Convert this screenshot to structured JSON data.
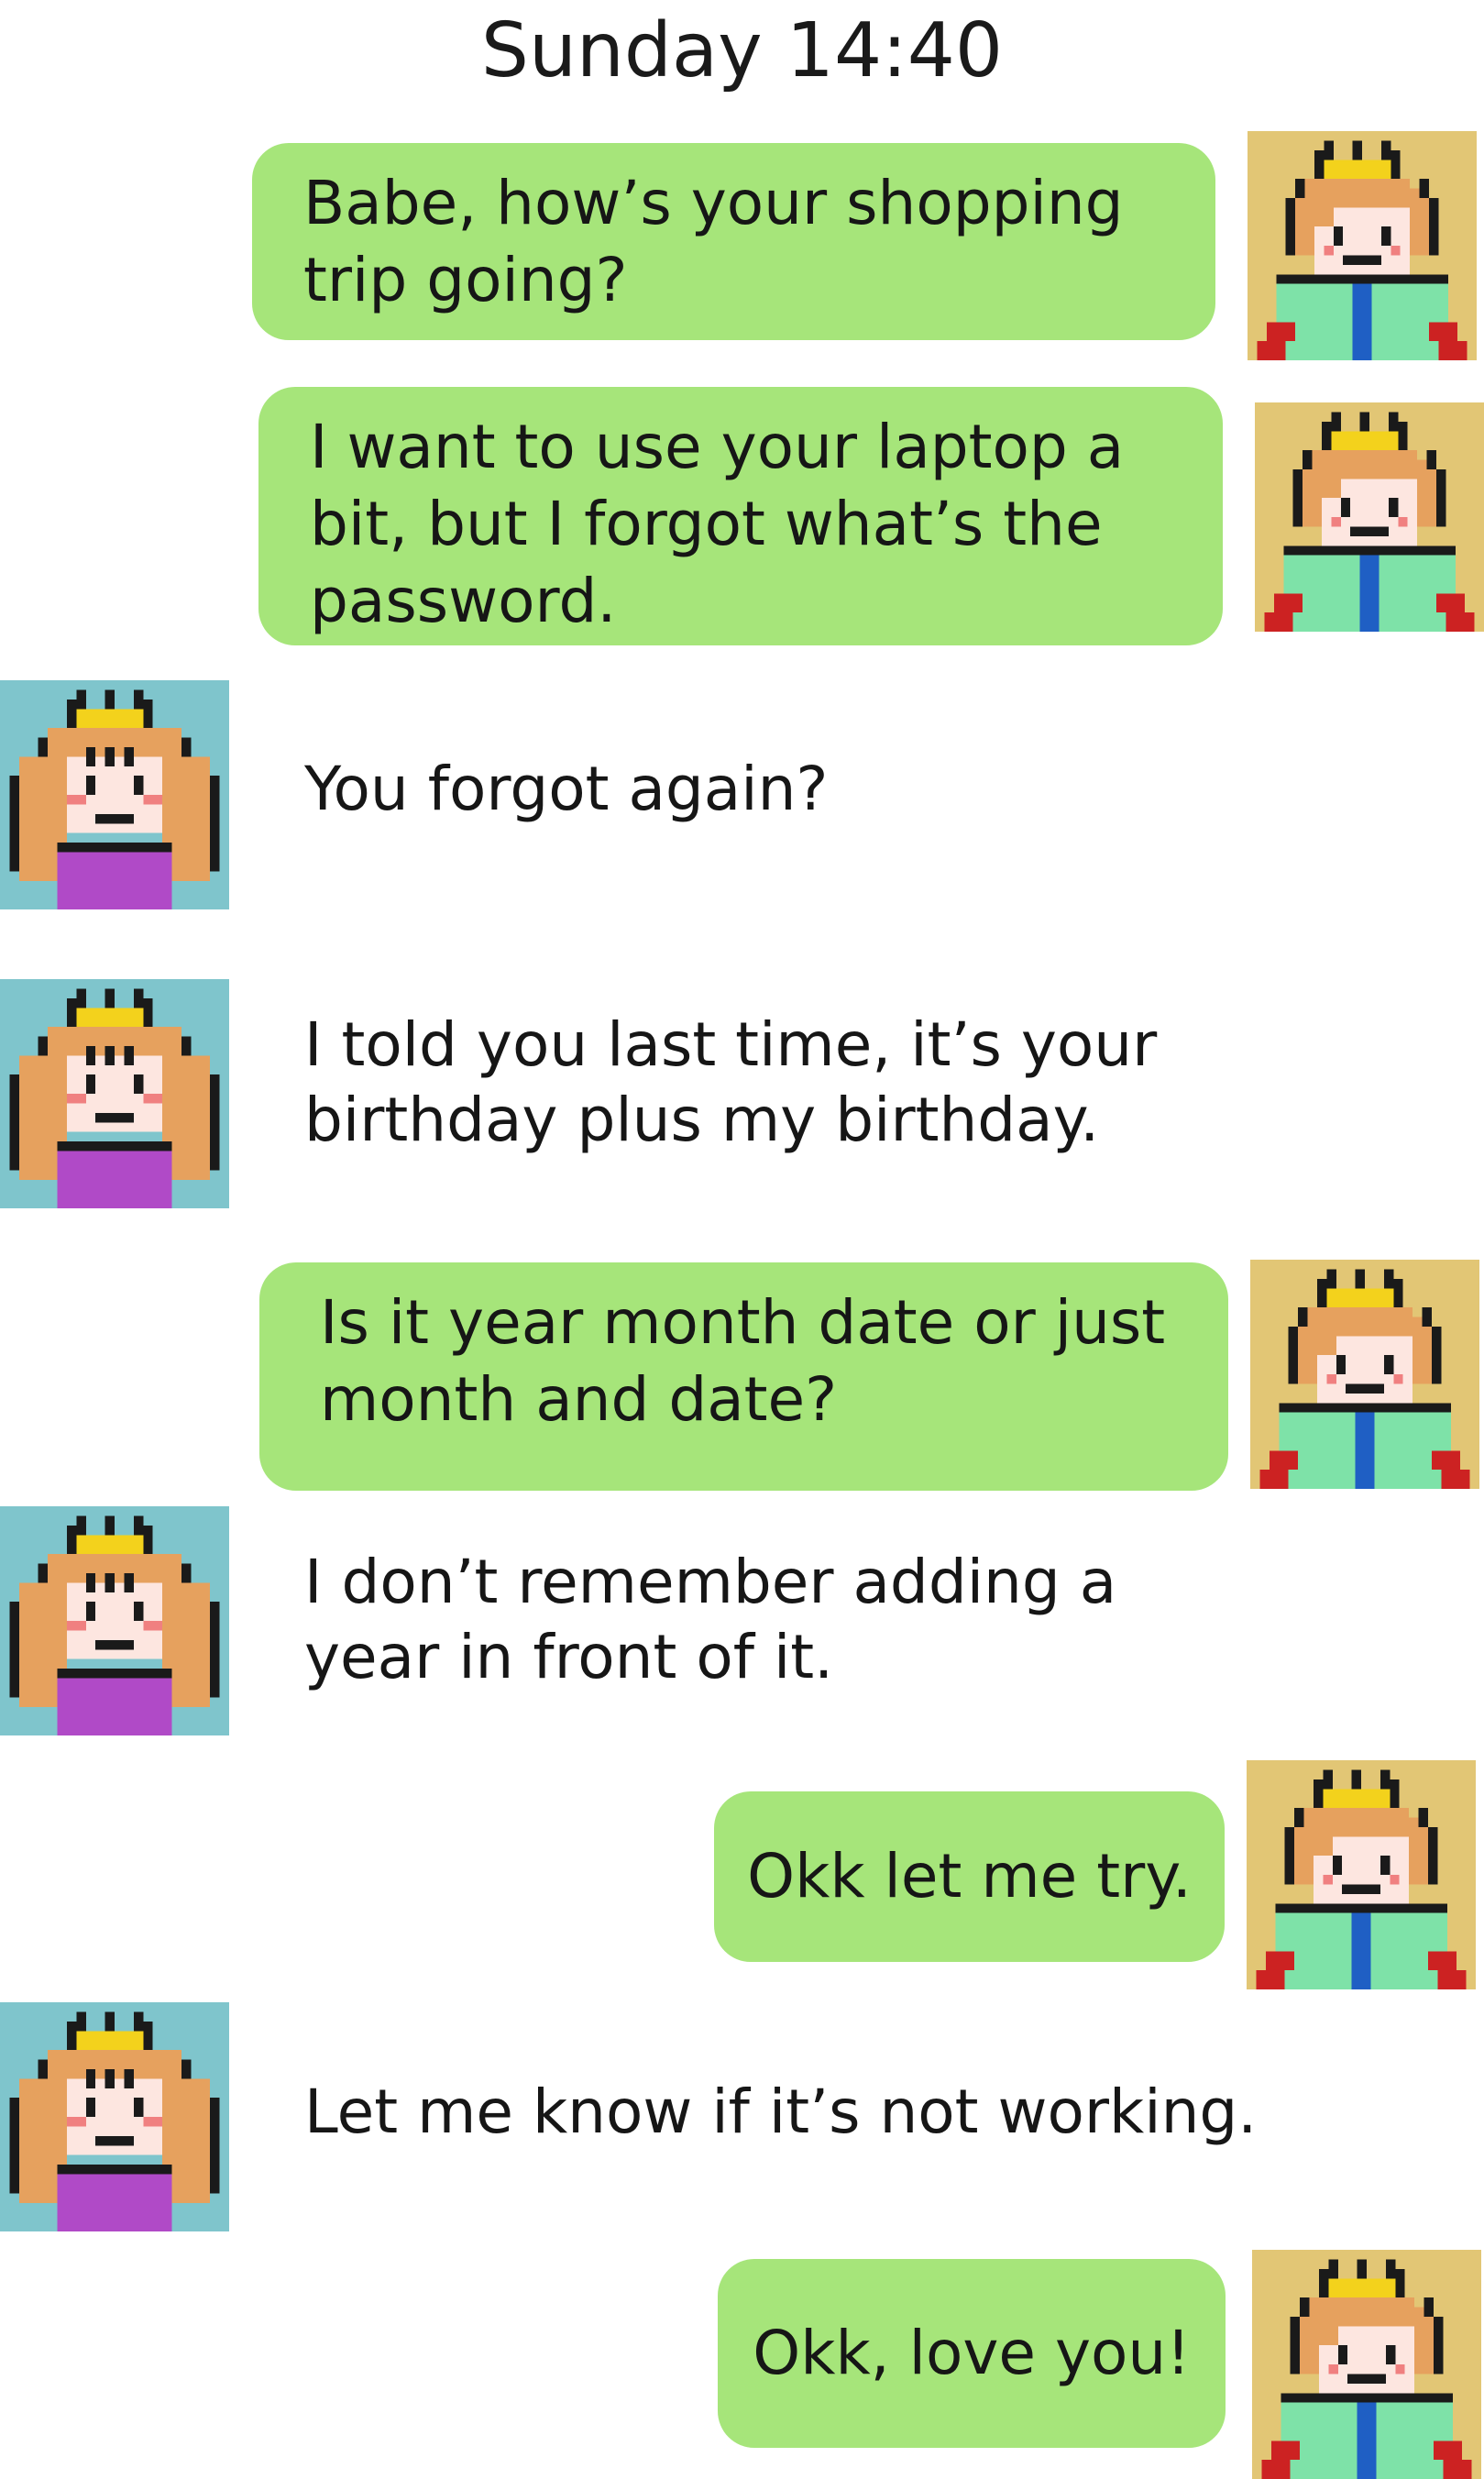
{
  "header": {
    "timestamp": "Sunday 14:40"
  },
  "participants": {
    "sender_avatar": "prince-avatar-icon",
    "receiver_avatar": "princess-avatar-icon"
  },
  "colors": {
    "sent_bubble": "#a6e57a",
    "prince_avatar_bg": "#e2c675",
    "princess_avatar_bg": "#7fc5cc",
    "text": "#161616"
  },
  "messages": [
    {
      "side": "sent",
      "text": "Babe, how’s your shopping\ntrip going?"
    },
    {
      "side": "sent",
      "text": "I want to use your laptop a\nbit, but I forgot what’s the\npassword."
    },
    {
      "side": "received",
      "text": "You forgot again?"
    },
    {
      "side": "received",
      "text": "I told you last time, it’s your\nbirthday plus my birthday."
    },
    {
      "side": "sent",
      "text": "Is it year month date or just\nmonth and date?"
    },
    {
      "side": "received",
      "text": "I don’t remember adding a\nyear in front of it."
    },
    {
      "side": "sent",
      "text": "Okk let me try."
    },
    {
      "side": "received",
      "text": "Let me know if it’s not working."
    },
    {
      "side": "sent",
      "text": "Okk, love you!"
    }
  ]
}
